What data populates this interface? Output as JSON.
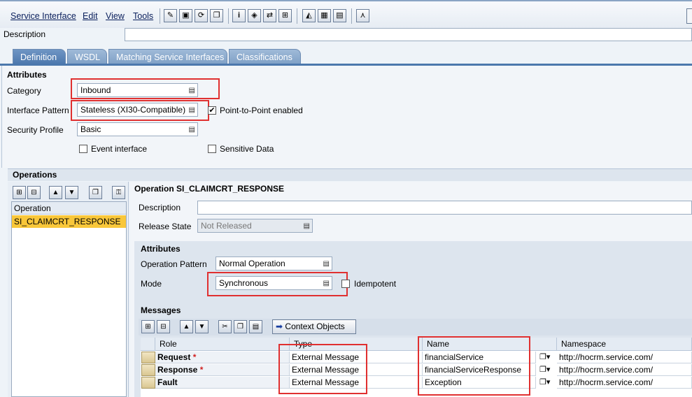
{
  "menu": {
    "items": [
      "Service Interface",
      "Edit",
      "View",
      "Tools"
    ]
  },
  "toolbar": {
    "icons": [
      "pencil-glasses-icon",
      "save-icon",
      "refresh-icon",
      "copy-icon",
      "info-icon",
      "paint-icon",
      "hierarchy-icon",
      "network-icon",
      "puzzle-icon",
      "table-icon",
      "book-icon",
      "branch-icon"
    ]
  },
  "header": {
    "description_label": "Description",
    "description_value": ""
  },
  "tabs": [
    "Definition",
    "WSDL",
    "Matching Service Interfaces",
    "Classifications"
  ],
  "attributes": {
    "title": "Attributes",
    "category_label": "Category",
    "category_value": "Inbound",
    "pattern_label": "Interface Pattern",
    "pattern_value": "Stateless (XI30-Compatible)",
    "p2p_label": "Point-to-Point enabled",
    "security_label": "Security Profile",
    "security_value": "Basic",
    "event_label": "Event interface",
    "sensitive_label": "Sensitive Data"
  },
  "operations": {
    "title": "Operations",
    "list_header": "Operation",
    "items": [
      "SI_CLAIMCRT_RESPONSE"
    ]
  },
  "operation_detail": {
    "title": "Operation SI_CLAIMCRT_RESPONSE",
    "description_label": "Description",
    "description_value": "",
    "release_label": "Release State",
    "release_value": "Not Released",
    "attributes_title": "Attributes",
    "op_pattern_label": "Operation Pattern",
    "op_pattern_value": "Normal Operation",
    "mode_label": "Mode",
    "mode_value": "Synchronous",
    "idempotent_label": "Idempotent"
  },
  "messages": {
    "title": "Messages",
    "context_button": "Context Objects",
    "columns": [
      "Role",
      "Type",
      "Name",
      "Namespace"
    ],
    "rows": [
      {
        "role": "Request",
        "required": "*",
        "type": "External Message",
        "name": "financialService",
        "namespace": "http://hocrm.service.com/"
      },
      {
        "role": "Response",
        "required": "*",
        "type": "External Message",
        "name": "financialServiceResponse",
        "namespace": "http://hocrm.service.com/"
      },
      {
        "role": "Fault",
        "required": "",
        "type": "External Message",
        "name": "Exception",
        "namespace": "http://hocrm.service.com/"
      }
    ]
  },
  "colors": {
    "highlight_red": "#e03030",
    "selected_row": "#f9c73a",
    "tab_blue": "#4c78ad"
  }
}
